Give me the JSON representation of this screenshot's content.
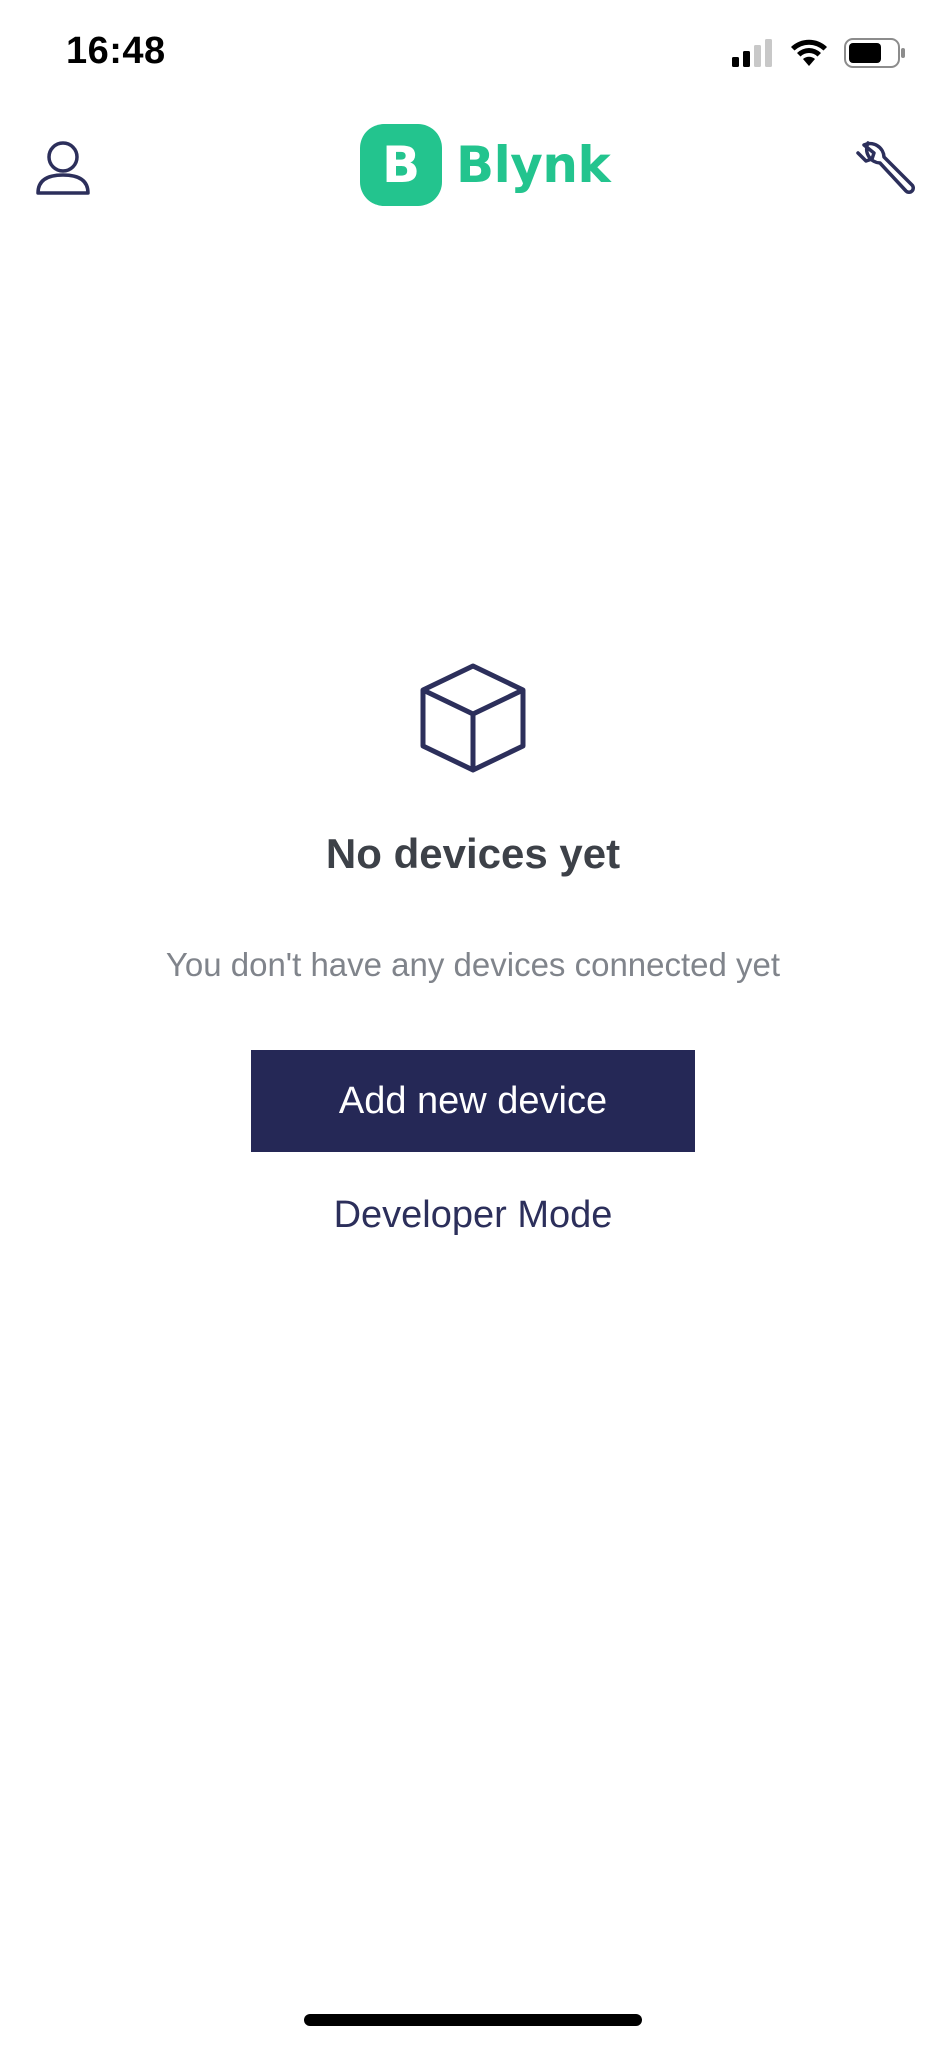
{
  "status_bar": {
    "time": "16:48",
    "icons": [
      "signal-icon",
      "wifi-icon",
      "battery-icon"
    ]
  },
  "header": {
    "logo_letter": "B",
    "logo_text": "Blynk",
    "left_icon": "person-icon",
    "right_icon": "wrench-icon"
  },
  "empty_state": {
    "icon": "cube-icon",
    "title": "No devices yet",
    "subtitle": "You don't have any devices connected yet",
    "add_button_label": "Add new device",
    "developer_mode_label": "Developer Mode"
  },
  "colors": {
    "brand": "#23c48e",
    "primary": "#252856",
    "title_text": "#3d4148",
    "subtitle_text": "#80848b"
  }
}
